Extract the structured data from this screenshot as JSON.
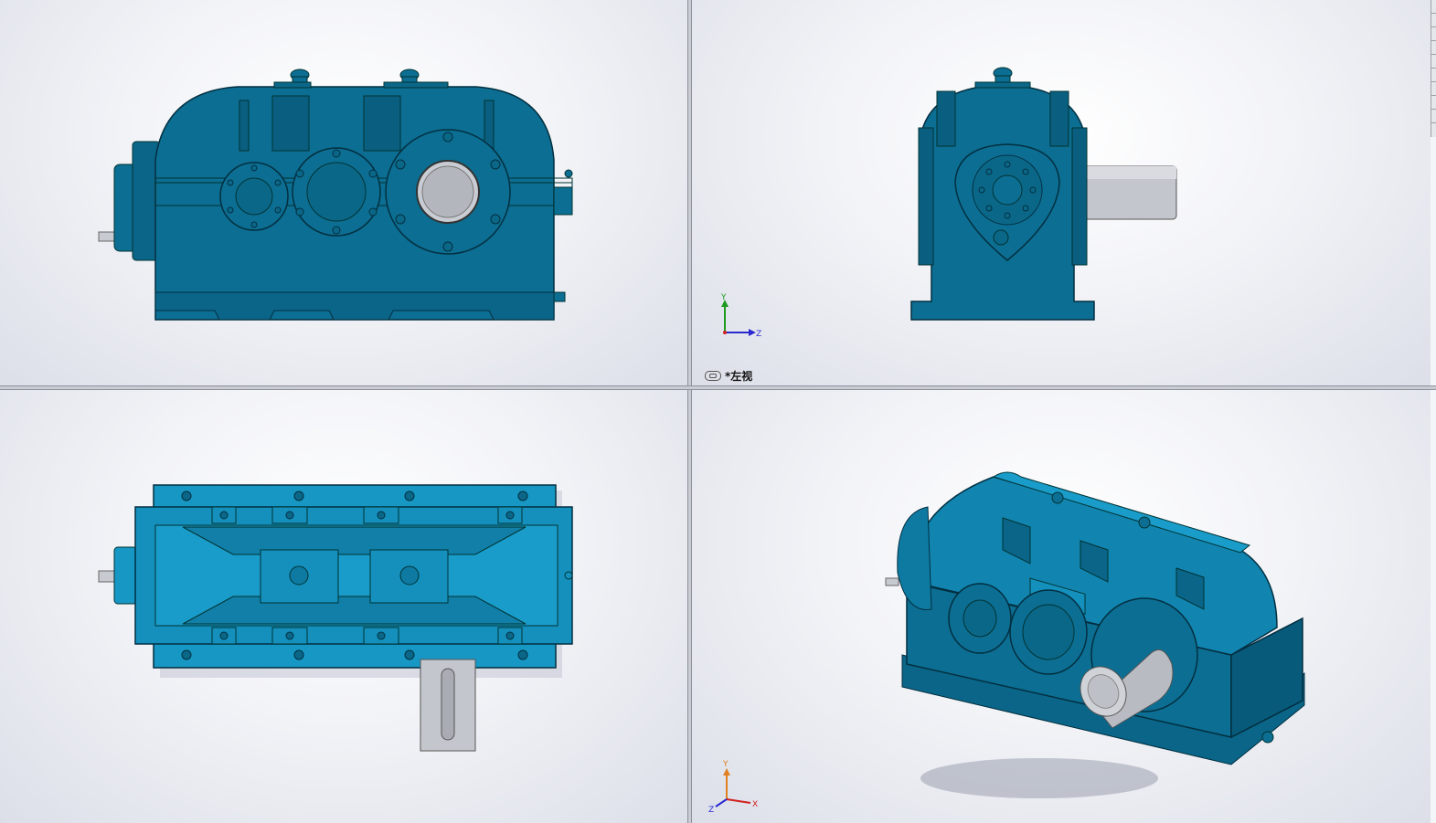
{
  "viewports": {
    "front": {
      "name": ""
    },
    "left": {
      "name": "*左视"
    },
    "top": {
      "name": ""
    },
    "iso": {
      "name": ""
    }
  },
  "triad": {
    "x": "X",
    "y": "Y",
    "z": "Z"
  },
  "colors": {
    "body": "#0c6e92",
    "body_dark": "#064e6a",
    "body_light": "#2a93b8",
    "top_view_body": "#1797c4",
    "shaft": "#b8bcc2",
    "background": "#eef0f5",
    "axis_x": "#d22020",
    "axis_y": "#1e9a1e",
    "axis_z": "#2a2ad0"
  },
  "icons": [
    "link-icon",
    "triad-icon"
  ]
}
